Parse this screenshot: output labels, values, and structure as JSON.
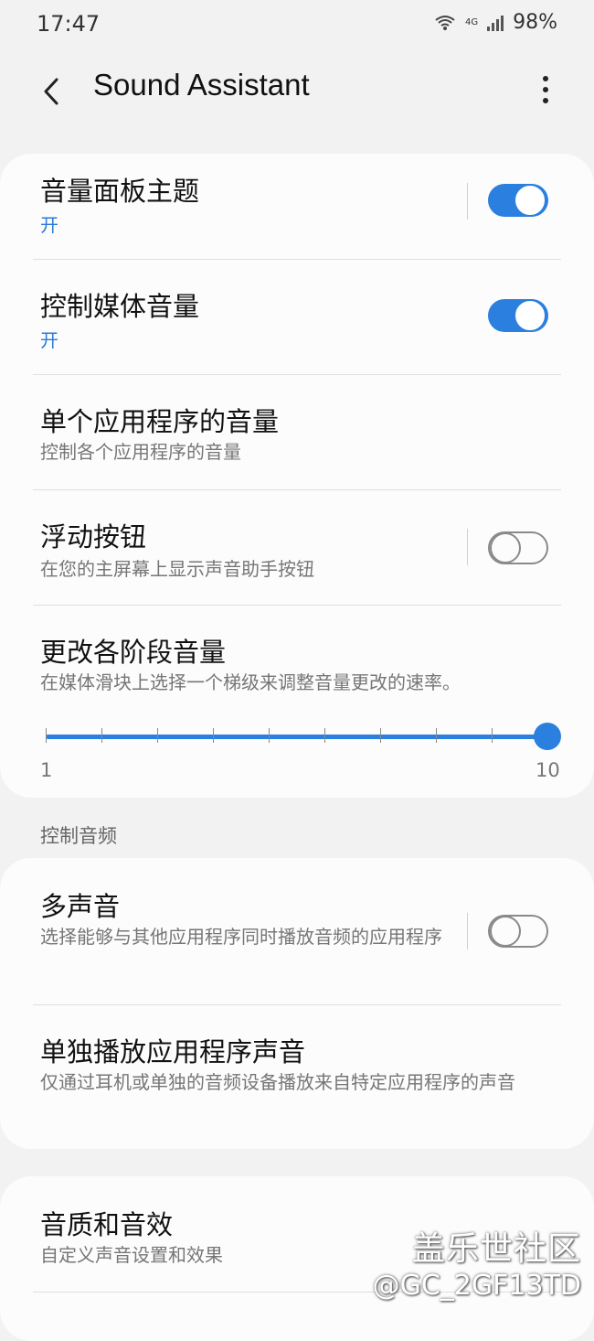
{
  "status": {
    "time": "17:47",
    "network": "4G",
    "battery": "98%",
    "icons": [
      "wifi-icon",
      "cellular-signal-icon"
    ]
  },
  "header": {
    "back_icon": "chevron-left-icon",
    "title": "Sound Assistant",
    "more_icon": "more-vertical-icon"
  },
  "card1": {
    "volume_panel_theme": {
      "title": "音量面板主题",
      "status": "开",
      "enabled": true
    },
    "control_media_volume": {
      "title": "控制媒体音量",
      "status": "开",
      "enabled": true
    },
    "per_app_volume": {
      "title": "单个应用程序的音量",
      "subtitle": "控制各个应用程序的音量"
    },
    "floating_button": {
      "title": "浮动按钮",
      "subtitle": "在您的主屏幕上显示声音助手按钮",
      "enabled": false
    },
    "volume_steps": {
      "title": "更改各阶段音量",
      "subtitle": "在媒体滑块上选择一个梯级来调整音量更改的速率。",
      "min_label": "1",
      "max_label": "10",
      "value": 10
    }
  },
  "section_label": "控制音频",
  "card2": {
    "multi_sound": {
      "title": "多声音",
      "subtitle": "选择能够与其他应用程序同时播放音频的应用程序",
      "enabled": false
    },
    "separate_app_sound": {
      "title": "单独播放应用程序声音",
      "subtitle": "仅通过耳机或单独的音频设备播放来自特定应用程序的声音"
    }
  },
  "card3": {
    "sound_quality": {
      "title": "音质和音效",
      "subtitle": "自定义声音设置和效果"
    }
  },
  "watermark": {
    "line1": "盖乐世社区",
    "line2": "@GC_2GF13TD"
  },
  "colors": {
    "accent": "#2b7fde",
    "background": "#f2f2f2",
    "card": "#fcfcfc"
  }
}
